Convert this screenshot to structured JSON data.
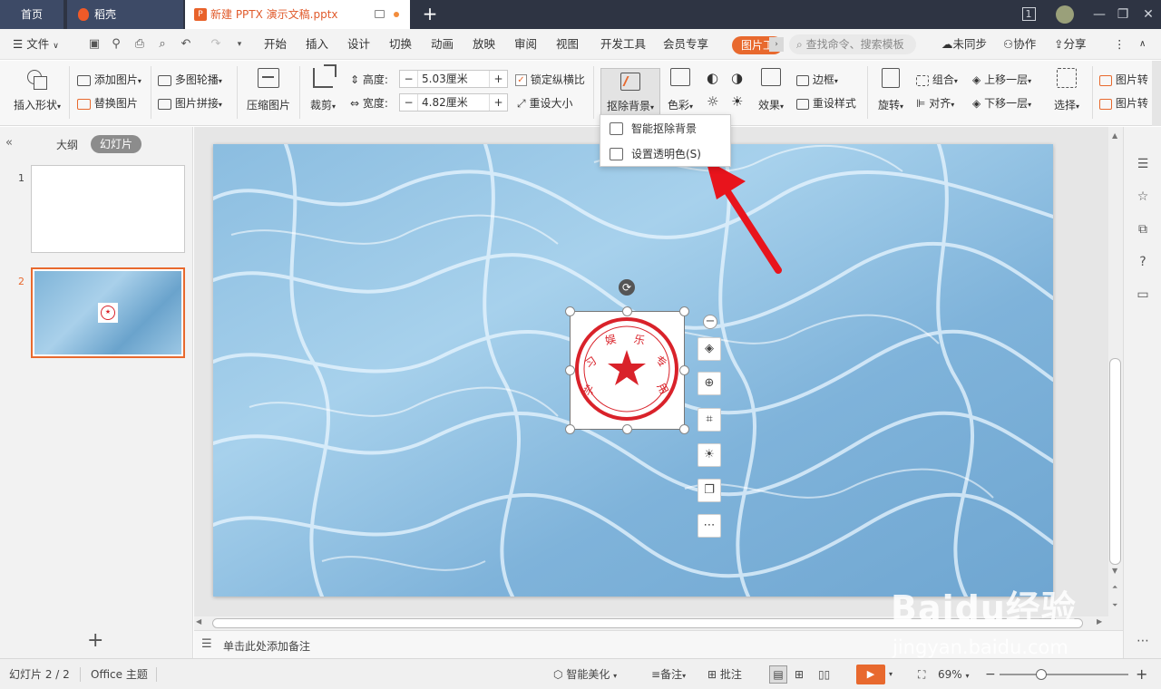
{
  "tabs": {
    "home": "首页",
    "daoke": "稻壳",
    "document": "新建 PPTX 演示文稿.pptx"
  },
  "window": {
    "badge": "1"
  },
  "menu": {
    "file": "文件",
    "items": [
      "开始",
      "插入",
      "设计",
      "切换",
      "动画",
      "放映",
      "审阅",
      "视图",
      "开发工具",
      "会员专享"
    ],
    "picture_tool": "图片工",
    "search_placeholder": "查找命令、搜索模板",
    "sync": "未同步",
    "collab": "协作",
    "share": "分享"
  },
  "ribbon": {
    "insert_shape": "插入形状",
    "add_picture": "添加图片",
    "replace_picture": "替换图片",
    "multi_carousel": "多图轮播",
    "picture_collage": "图片拼接",
    "compress": "压缩图片",
    "crop": "裁剪",
    "height_label": "高度:",
    "height_value": "5.03厘米",
    "width_label": "宽度:",
    "width_value": "4.82厘米",
    "lock_ratio": "锁定纵横比",
    "reset_size": "重设大小",
    "remove_bg": "抠除背景",
    "color": "色彩",
    "effects": "效果",
    "border": "边框",
    "reset_style": "重设样式",
    "rotate": "旋转",
    "group": "组合",
    "align": "对齐",
    "bring_forward": "上移一层",
    "send_backward": "下移一层",
    "select": "选择",
    "picture_right_1": "图片转",
    "picture_right_2": "图片转"
  },
  "dropdown": {
    "smart_remove": "智能抠除背景",
    "set_transparent": "设置透明色(S)"
  },
  "left_panel": {
    "outline": "大纲",
    "slides": "幻灯片",
    "slide_numbers": [
      "1",
      "2"
    ]
  },
  "stamp": {
    "text": "学习娱乐专用"
  },
  "notes": {
    "placeholder": "单击此处添加备注"
  },
  "status": {
    "slide_count": "幻灯片 2 / 2",
    "theme": "Office 主题",
    "beautify": "智能美化",
    "notes": "备注",
    "comments": "批注",
    "zoom": "69%"
  },
  "watermark": {
    "brand": "Baidu经验",
    "url": "jingyan.baidu.com"
  },
  "colors": {
    "accent": "#e8692e",
    "stamp_red": "#d9222a",
    "arrow_red": "#e8141c",
    "titlebar": "#2e3443"
  }
}
